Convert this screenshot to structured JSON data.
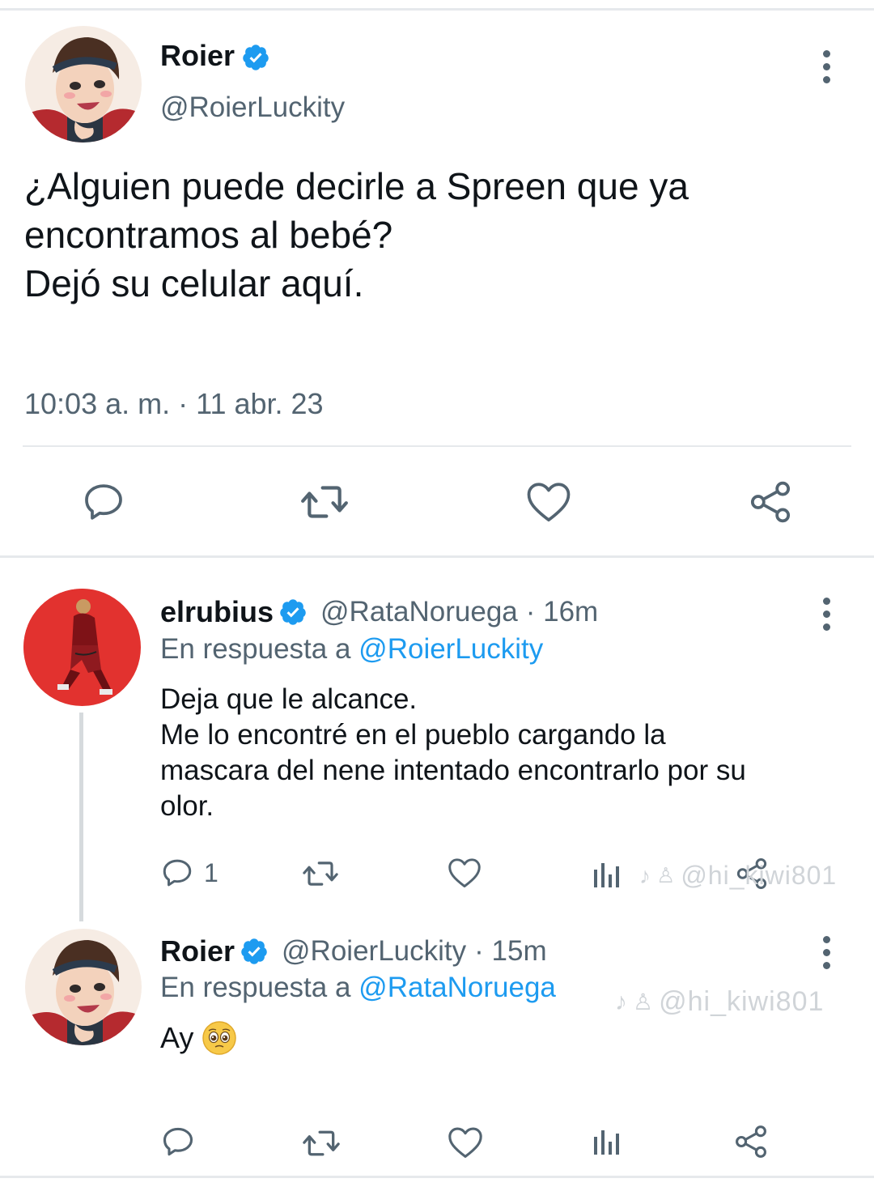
{
  "main_tweet": {
    "author_name": "Roier",
    "author_handle": "@RoierLuckity",
    "text": "¿Alguien puede decirle a Spreen que ya\nencontramos al bebé?\nDejó su celular aquí.",
    "timestamp": "10:03 a. m. · 11 abr. 23"
  },
  "reply1": {
    "author_name": "elrubius",
    "author_handle": "@RataNoruega",
    "time": "· 16m",
    "reply_prefix": "En respuesta a",
    "reply_to": "@RoierLuckity",
    "text": "Deja que le alcance.\nMe lo encontré en el pueblo cargando la\nmascara del nene intentado encontrarlo por su\nolor.",
    "reply_count": "1"
  },
  "reply2": {
    "author_name": "Roier",
    "author_handle": "@RoierLuckity",
    "time": "· 15m",
    "reply_prefix": "En respuesta a",
    "reply_to": "@RataNoruega",
    "text": "Ay"
  },
  "watermark": {
    "text": "@hi_kiwi801"
  },
  "colors": {
    "verified": "#1d9bf0",
    "link": "#1d9bf0",
    "secondary_text": "#536471",
    "divider": "#e6e9ec",
    "rubius_avatar_bg": "#e2322f"
  },
  "icons": [
    "verified-badge-icon",
    "more-options-icon",
    "reply-icon",
    "retweet-icon",
    "like-icon",
    "share-icon",
    "analytics-icon",
    "pleading-face-emoji"
  ]
}
